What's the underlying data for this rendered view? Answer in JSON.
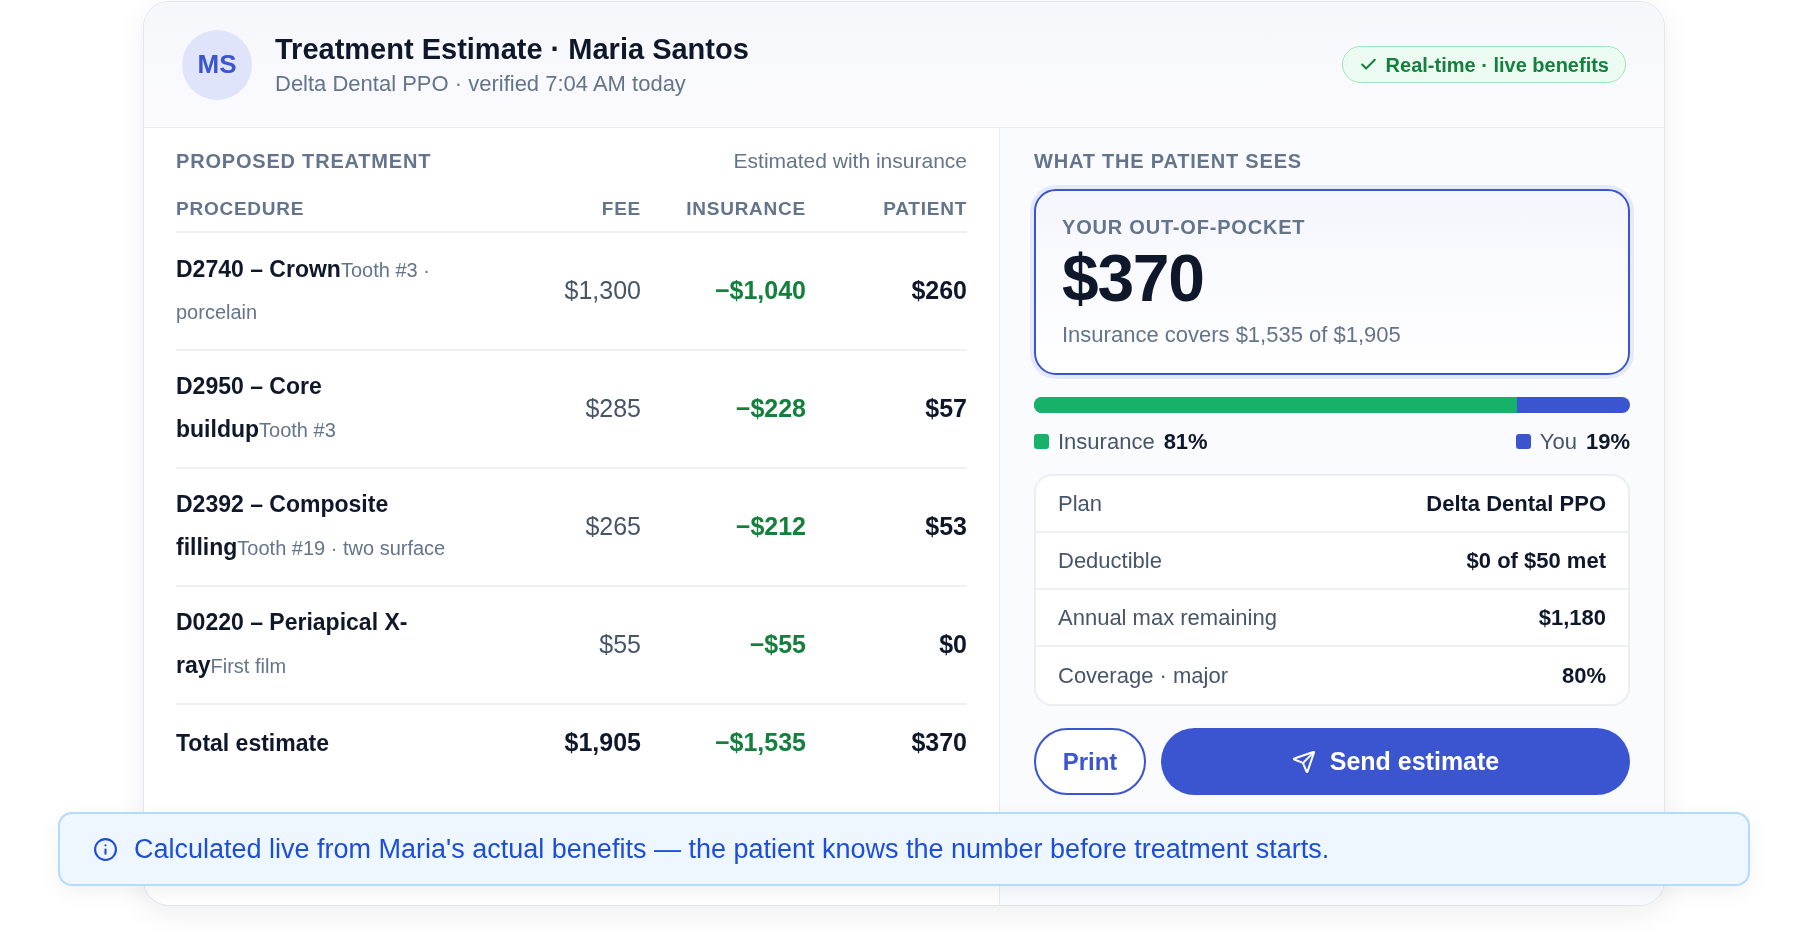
{
  "header": {
    "initials": "MS",
    "title": "Treatment Estimate · Maria Santos",
    "subtitle": "Delta Dental PPO · verified 7:04 AM today",
    "badge": "Real-time · live benefits"
  },
  "treatment": {
    "heading": "PROPOSED TREATMENT",
    "note": "Estimated with insurance",
    "columns": [
      "PROCEDURE",
      "FEE",
      "INSURANCE",
      "PATIENT"
    ],
    "rows": [
      {
        "procedure": "D2740 – Crown",
        "detail": "Tooth #3 · porcelain",
        "fee": "$1,300",
        "insurance": "−$1,040",
        "patient": "$260"
      },
      {
        "procedure": "D2950 – Core buildup",
        "detail": "Tooth #3",
        "fee": "$285",
        "insurance": "−$228",
        "patient": "$57"
      },
      {
        "procedure": "D2392 – Composite filling",
        "detail": "Tooth #19 · two surface",
        "fee": "$265",
        "insurance": "−$212",
        "patient": "$53"
      },
      {
        "procedure": "D0220 – Periapical X-ray",
        "detail": "First film",
        "fee": "$55",
        "insurance": "−$55",
        "patient": "$0"
      }
    ],
    "total": {
      "label": "Total estimate",
      "fee": "$1,905",
      "insurance": "−$1,535",
      "patient": "$370"
    }
  },
  "patient_view": {
    "heading": "WHAT THE PATIENT SEES",
    "out_of_pocket": {
      "label": "YOUR OUT-OF-POCKET",
      "amount": "$370",
      "caption": "Insurance covers $1,535 of $1,905"
    },
    "split": {
      "level": 0.81,
      "legend": [
        {
          "label": "Insurance",
          "value": "81%",
          "color": "#17b26a"
        },
        {
          "label": "You",
          "value": "19%",
          "color": "#3b55d1"
        }
      ]
    },
    "details": [
      {
        "label": "Plan",
        "value": "Delta Dental PPO"
      },
      {
        "label": "Deductible",
        "value": "$0 of $50 met"
      },
      {
        "label": "Annual max remaining",
        "value": "$1,180"
      },
      {
        "label": "Coverage · major",
        "value": "80%"
      }
    ],
    "buttons": [
      {
        "label": "Print",
        "kind": "outline"
      },
      {
        "label": "Send estimate",
        "kind": "primary"
      }
    ]
  },
  "banner": {
    "text": "Calculated live from Maria's actual benefits — the patient knows the number before treatment starts."
  }
}
